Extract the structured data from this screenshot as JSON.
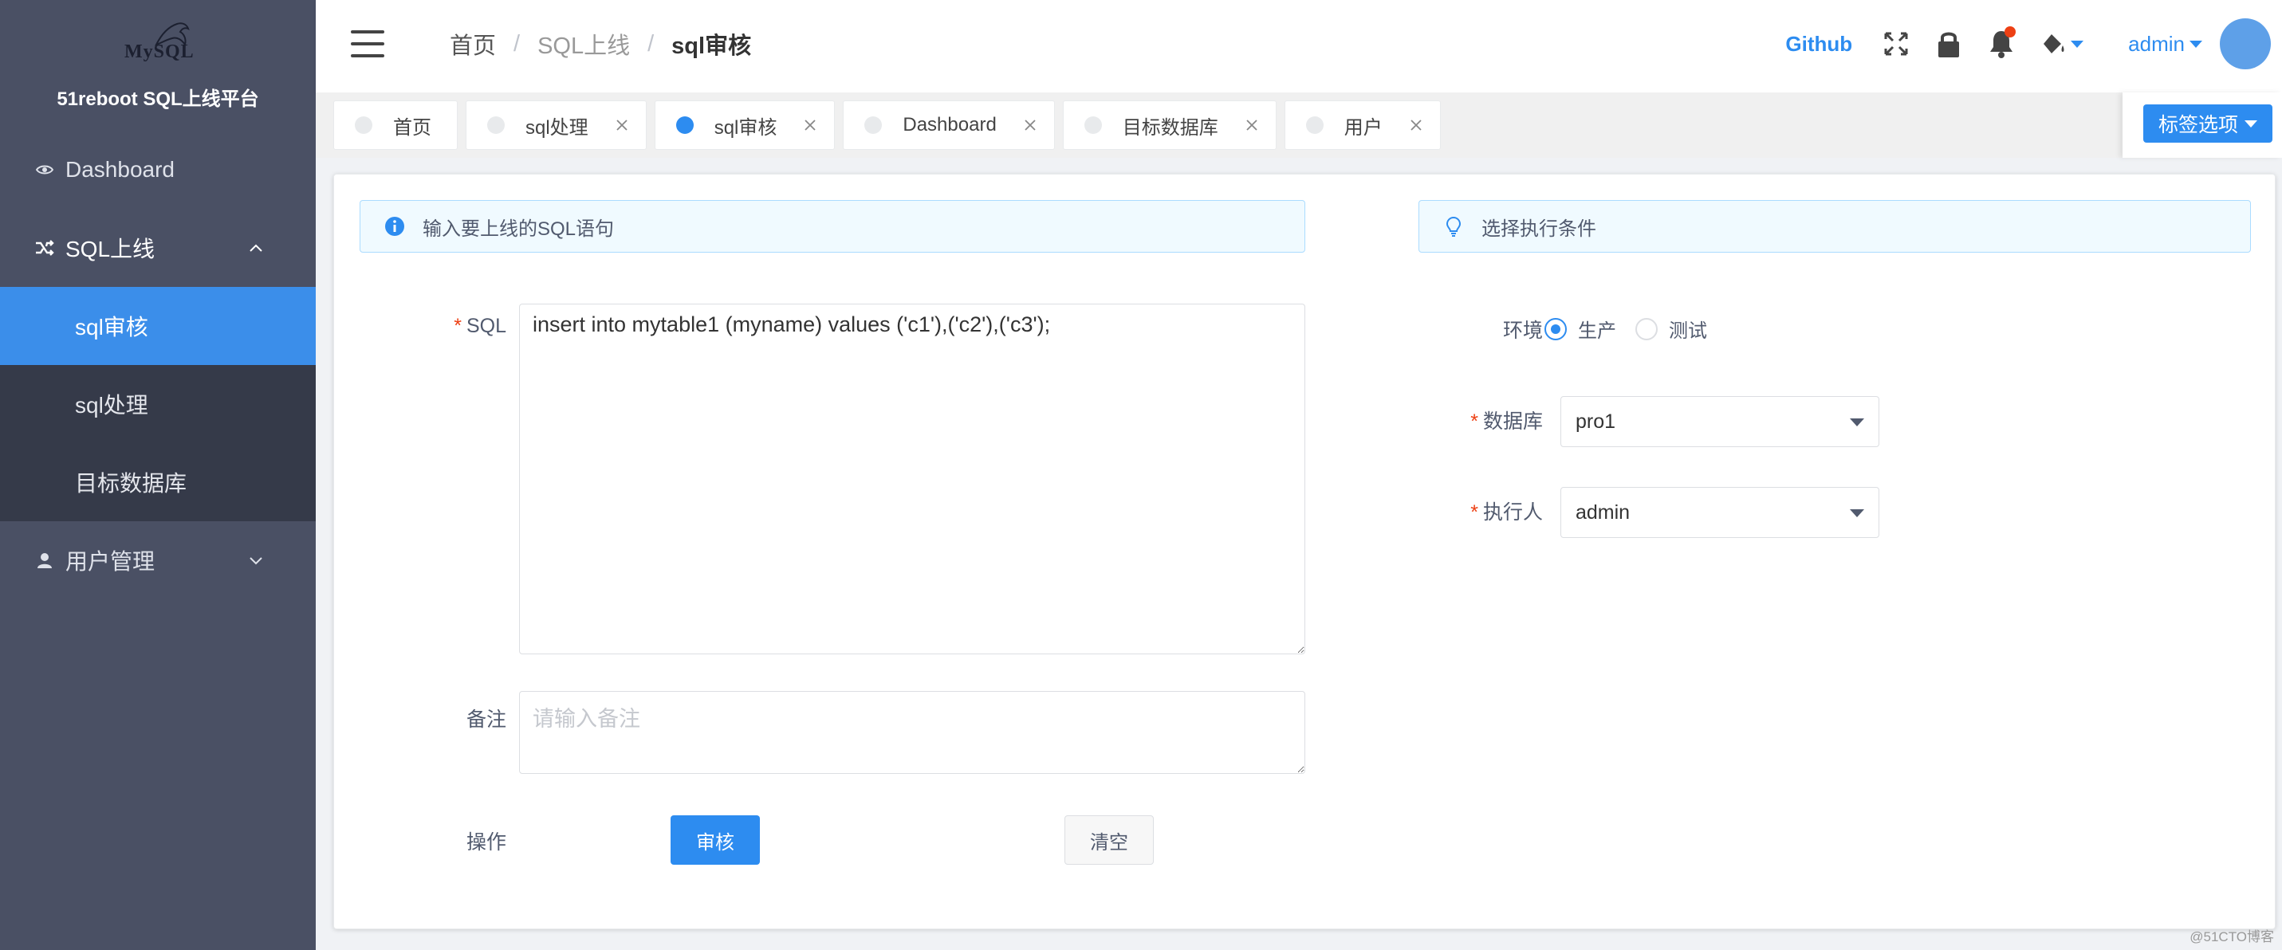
{
  "sidebar": {
    "logo_text": "MySQL",
    "site_name": "51reboot SQL上线平台",
    "items": [
      {
        "label": "Dashboard",
        "icon": "eye-icon"
      },
      {
        "label": "SQL上线",
        "icon": "shuffle-icon",
        "expanded": true,
        "children": [
          {
            "label": "sql审核",
            "active": true
          },
          {
            "label": "sql处理"
          },
          {
            "label": "目标数据库"
          }
        ]
      },
      {
        "label": "用户管理",
        "icon": "user-icon",
        "expanded": false
      }
    ]
  },
  "header": {
    "breadcrumb": [
      "首页",
      "SQL上线",
      "sql审核"
    ],
    "github_label": "Github",
    "user_name": "admin"
  },
  "tabs": [
    {
      "label": "首页",
      "closable": false,
      "active": false
    },
    {
      "label": "sql处理",
      "closable": true,
      "active": false
    },
    {
      "label": "sql审核",
      "closable": true,
      "active": true
    },
    {
      "label": "Dashboard",
      "closable": true,
      "active": false
    },
    {
      "label": "目标数据库",
      "closable": true,
      "active": false
    },
    {
      "label": "用户",
      "closable": true,
      "active": false
    }
  ],
  "tag_options_label": "标签选项",
  "form": {
    "left_alert": "输入要上线的SQL语句",
    "right_alert": "选择执行条件",
    "sql_label": "SQL",
    "sql_value": "insert into mytable1 (myname) values ('c1'),('c2'),('c3');",
    "note_label": "备注",
    "note_placeholder": "请输入备注",
    "action_label": "操作",
    "submit_label": "审核",
    "clear_label": "清空",
    "env_label": "环境",
    "env_options": [
      "生产",
      "测试"
    ],
    "env_selected": "生产",
    "db_label": "数据库",
    "db_value": "pro1",
    "executor_label": "执行人",
    "executor_value": "admin"
  },
  "watermark": "@51CTO博客",
  "colors": {
    "primary": "#2d8cf0",
    "sidebar_bg": "#4a5064",
    "submenu_bg": "#353a49",
    "active_item": "#3b8eea",
    "danger": "#ed4014"
  }
}
